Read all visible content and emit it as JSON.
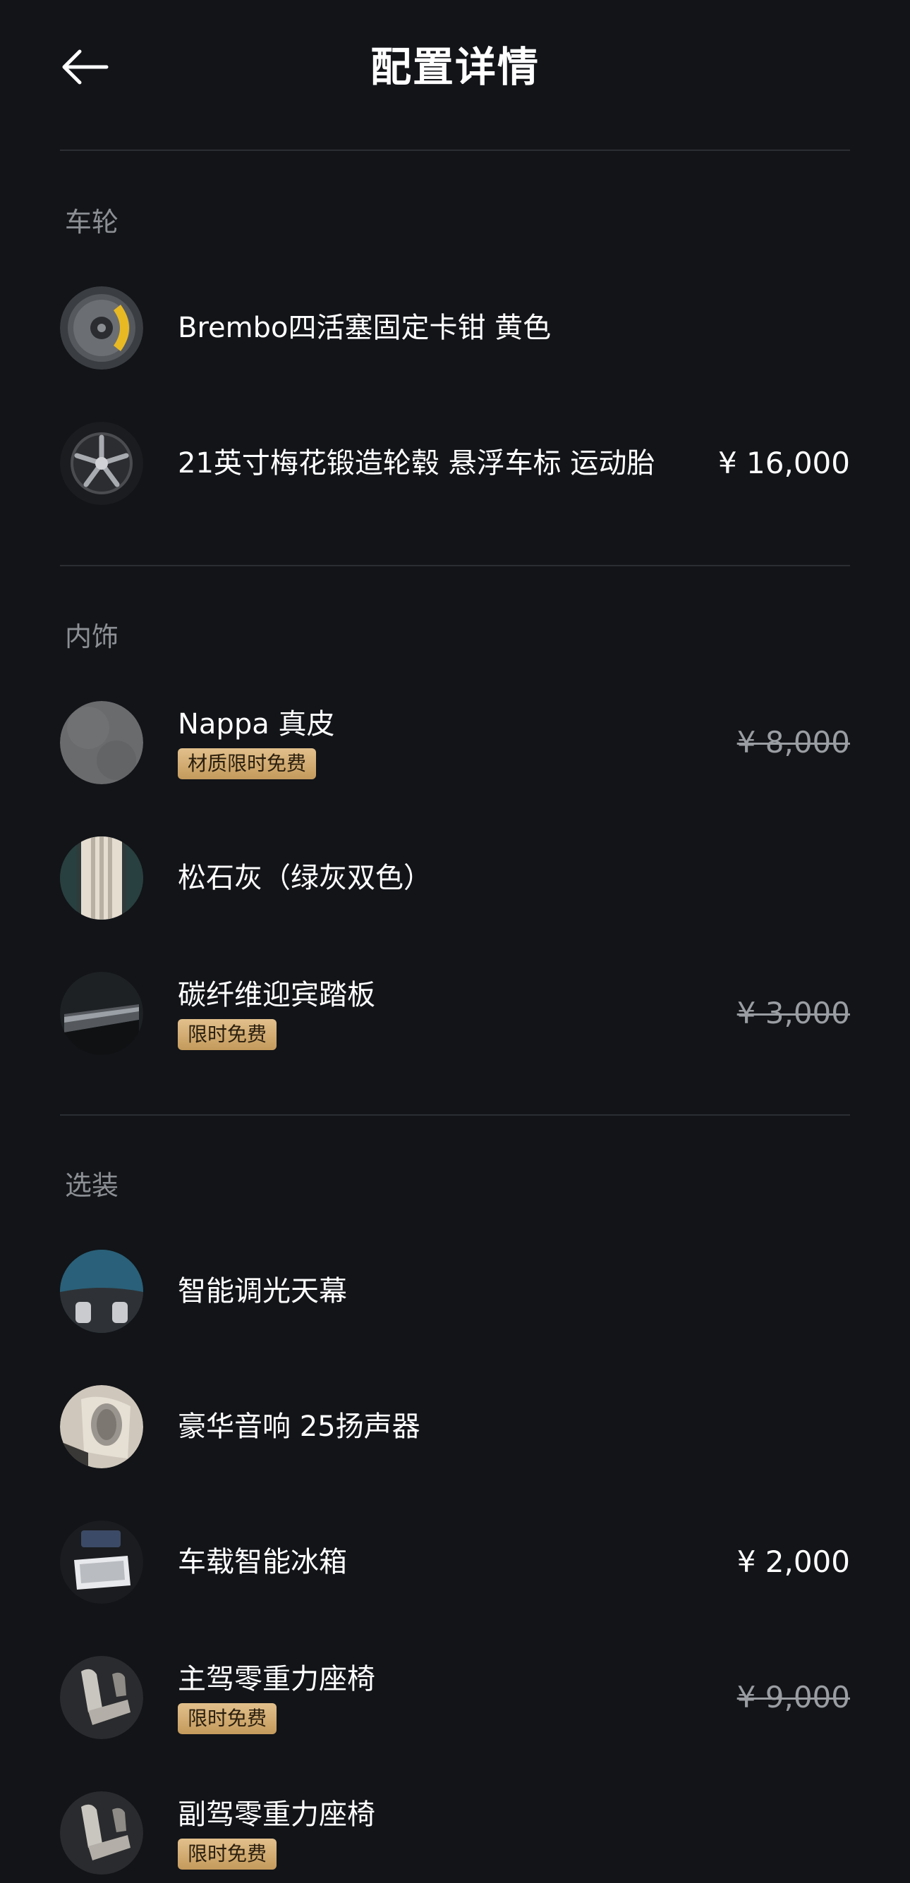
{
  "header": {
    "title": "配置详情",
    "back_icon": "arrow-left-icon"
  },
  "sections": [
    {
      "title": "车轮",
      "items": [
        {
          "name": "Brembo四活塞固定卡钳 黄色",
          "price": "",
          "badge": "",
          "icon": "brake-caliper-icon"
        },
        {
          "name": "21英寸梅花锻造轮毂 悬浮车标 运动胎",
          "price": "¥ 16,000",
          "badge": "",
          "icon": "wheel-icon"
        }
      ]
    },
    {
      "title": "内饰",
      "items": [
        {
          "name": "Nappa 真皮",
          "price": "¥ 8,000",
          "badge": "材质限时免费",
          "icon": "leather-swatch-icon"
        },
        {
          "name": "松石灰（绿灰双色）",
          "price": "",
          "badge": "",
          "icon": "interior-color-swatch-icon"
        },
        {
          "name": "碳纤维迎宾踏板",
          "price": "¥ 3,000",
          "badge": "限时免费",
          "icon": "door-sill-icon"
        }
      ]
    },
    {
      "title": "选装",
      "items": [
        {
          "name": "智能调光天幕",
          "price": "",
          "badge": "",
          "icon": "sunroof-icon"
        },
        {
          "name": "豪华音响 25扬声器",
          "price": "",
          "badge": "",
          "icon": "speaker-icon"
        },
        {
          "name": "车载智能冰箱",
          "price": "¥ 2,000",
          "badge": "",
          "icon": "fridge-icon"
        },
        {
          "name": "主驾零重力座椅",
          "price": "¥ 9,000",
          "badge": "限时免费",
          "icon": "seat-icon"
        },
        {
          "name": "副驾零重力座椅",
          "price": "",
          "badge": "限时免费",
          "icon": "seat-icon"
        }
      ]
    }
  ],
  "colors": {
    "background": "#121418",
    "divider": "#2b2e33",
    "section_title": "#8c8f94",
    "badge_gold": "#d4ad73",
    "struck_price": "#9a9da2"
  }
}
